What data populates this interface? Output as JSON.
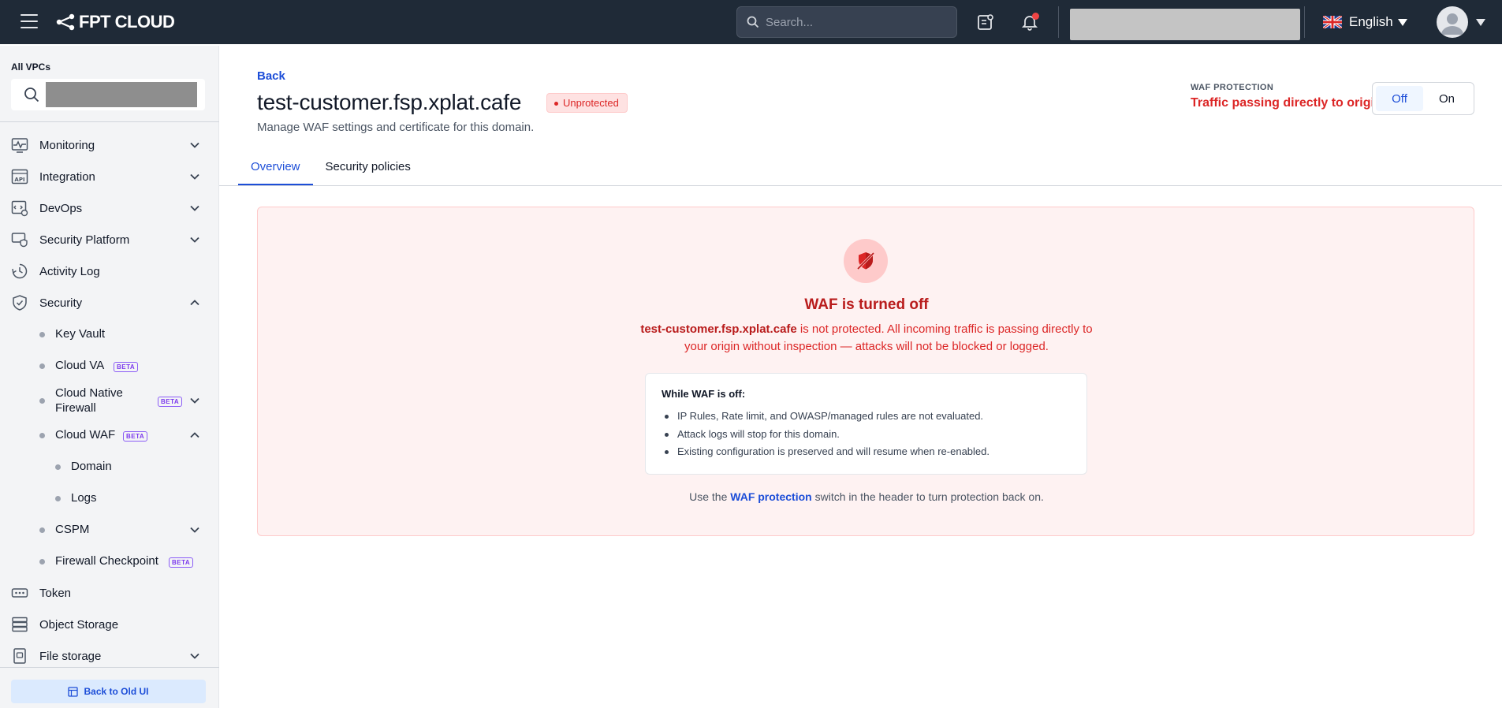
{
  "topbar": {
    "brand": "FPT CLOUD",
    "search_placeholder": "Search...",
    "language": "English"
  },
  "sidebar": {
    "vpc_label": "All VPCs",
    "items": [
      {
        "label": "Monitoring",
        "icon": "monitoring-icon"
      },
      {
        "label": "Integration",
        "icon": "api-icon"
      },
      {
        "label": "DevOps",
        "icon": "devops-icon"
      },
      {
        "label": "Security Platform",
        "icon": "security-platform-icon"
      },
      {
        "label": "Activity Log",
        "icon": "clock-icon"
      },
      {
        "label": "Security",
        "icon": "shield-icon"
      }
    ],
    "security_sub": {
      "key_vault": "Key Vault",
      "cloud_va": "Cloud VA",
      "cloud_native_firewall": "Cloud Native Firewall",
      "cloud_waf": "Cloud WAF",
      "domain": "Domain",
      "logs": "Logs",
      "cspm": "CSPM",
      "firewall_checkpoint": "Firewall Checkpoint"
    },
    "beta": "BETA",
    "bottom_items": [
      {
        "label": "Token",
        "icon": "token-icon"
      },
      {
        "label": "Object Storage",
        "icon": "object-storage-icon"
      },
      {
        "label": "File storage",
        "icon": "file-storage-icon"
      }
    ],
    "back_old_ui": "Back to Old UI"
  },
  "page": {
    "back": "Back",
    "domain": "test-customer.fsp.xplat.cafe",
    "status_badge": "Unprotected",
    "subtitle": "Manage WAF settings and certificate for this domain.",
    "waf_caption": "WAF PROTECTION",
    "waf_status": "Traffic passing directly to origin",
    "toggle_off": "Off",
    "toggle_on": "On",
    "toggle_value": "Off"
  },
  "tabs": [
    "Overview",
    "Security policies"
  ],
  "alert": {
    "title": "WAF is turned off",
    "desc_domain": "test-customer.fsp.xplat.cafe",
    "desc_rest": " is not protected. All incoming traffic is passing directly to your origin without inspection — attacks will not be blocked or logged.",
    "box_heading": "While WAF is off:",
    "box_items": [
      "IP Rules, Rate limit, and OWASP/managed rules are not evaluated.",
      "Attack logs will stop for this domain.",
      "Existing configuration is preserved and will resume when re-enabled."
    ],
    "footer_pre": "Use the ",
    "footer_link": "WAF protection",
    "footer_post": " switch in the header to turn protection back on."
  },
  "colors": {
    "topbar": "#1f2a37",
    "accent": "#1d4ed8",
    "danger": "#dc2626",
    "beta": "#7c3aed"
  }
}
